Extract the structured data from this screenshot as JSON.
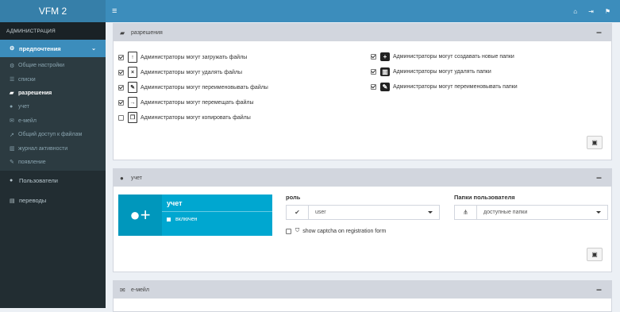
{
  "app": {
    "title": "VFM 2"
  },
  "sidebar": {
    "section": "АДМИНИСТРАЦИЯ",
    "prefs": {
      "label": "предпочтения"
    },
    "sub": [
      {
        "label": "Общие настройки",
        "icon": "gears-icon"
      },
      {
        "label": "списки",
        "icon": "list-icon"
      },
      {
        "label": "разрешения",
        "icon": "graduation-cap-icon",
        "current": true
      },
      {
        "label": "учет",
        "icon": "user-plus-icon"
      },
      {
        "label": "е-мейл",
        "icon": "envelope-icon"
      },
      {
        "label": "Общий доступ к файлам",
        "icon": "share-icon"
      },
      {
        "label": "журнал активности",
        "icon": "bar-chart-icon"
      },
      {
        "label": "появление",
        "icon": "paint-brush-icon"
      }
    ],
    "users": {
      "label": "Пользователи"
    },
    "translations": {
      "label": "переводы"
    }
  },
  "permissions": {
    "title": "разрешения",
    "left": [
      {
        "label": "Администраторы могут загружать файлы",
        "checked": true,
        "icon": "file-upload-icon"
      },
      {
        "label": "Администраторы могут удалять файлы",
        "checked": true,
        "icon": "file-delete-icon"
      },
      {
        "label": "Администраторы могут переименовывать файлы",
        "checked": true,
        "icon": "file-rename-icon"
      },
      {
        "label": "Администраторы могут перемещать файлы",
        "checked": true,
        "icon": "file-move-icon"
      },
      {
        "label": "Администраторы могут копировать файлы",
        "checked": false,
        "icon": "file-copy-icon"
      }
    ],
    "right": [
      {
        "label": "Администраторы могут создавать новые папки",
        "checked": true,
        "icon": "folder-plus-icon"
      },
      {
        "label": "Администраторы могут удалять папки",
        "checked": true,
        "icon": "folder-delete-icon"
      },
      {
        "label": "Администраторы могут переименовывать папки",
        "checked": true,
        "icon": "folder-rename-icon"
      }
    ]
  },
  "account": {
    "title": "учет",
    "card_title": "учет",
    "card_status": "включен",
    "role_label": "роль",
    "role_value": "user",
    "folders_label": "Папки пользователя",
    "folders_value": "доступные папки",
    "captcha_label": "show captcha on registration form",
    "captcha_checked": false
  },
  "email": {
    "title": "е-мейл"
  },
  "colors": {
    "primary": "#3c8dbc",
    "sidebar": "#222d32",
    "card": "#00a7d0"
  }
}
